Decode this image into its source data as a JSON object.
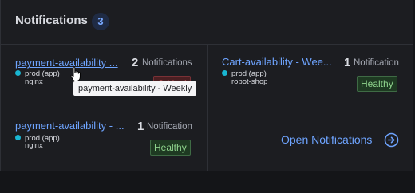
{
  "header": {
    "title": "Notifications",
    "count": "3"
  },
  "cards": [
    {
      "name": "payment-availability ...",
      "env": "prod (app)",
      "service": "nginx",
      "count": "2",
      "count_label": "Notifications",
      "status": "Critical"
    },
    {
      "name": "Cart-availability - Wee...",
      "env": "prod (app)",
      "service": "robot-shop",
      "count": "1",
      "count_label": "Notification",
      "status": "Healthy"
    },
    {
      "name": "payment-availability - ...",
      "env": "prod (app)",
      "service": "nginx",
      "count": "1",
      "count_label": "Notification",
      "status": "Healthy"
    }
  ],
  "tooltip": "payment-availability - Weekly",
  "open_notifications": {
    "label": "Open Notifications",
    "icon": "arrow-right-circle-icon"
  },
  "colors": {
    "accent": "#6ea4ff",
    "env_dot": "#19b6d2",
    "healthy": "#8fd48d",
    "critical": "#ff7b7f"
  }
}
